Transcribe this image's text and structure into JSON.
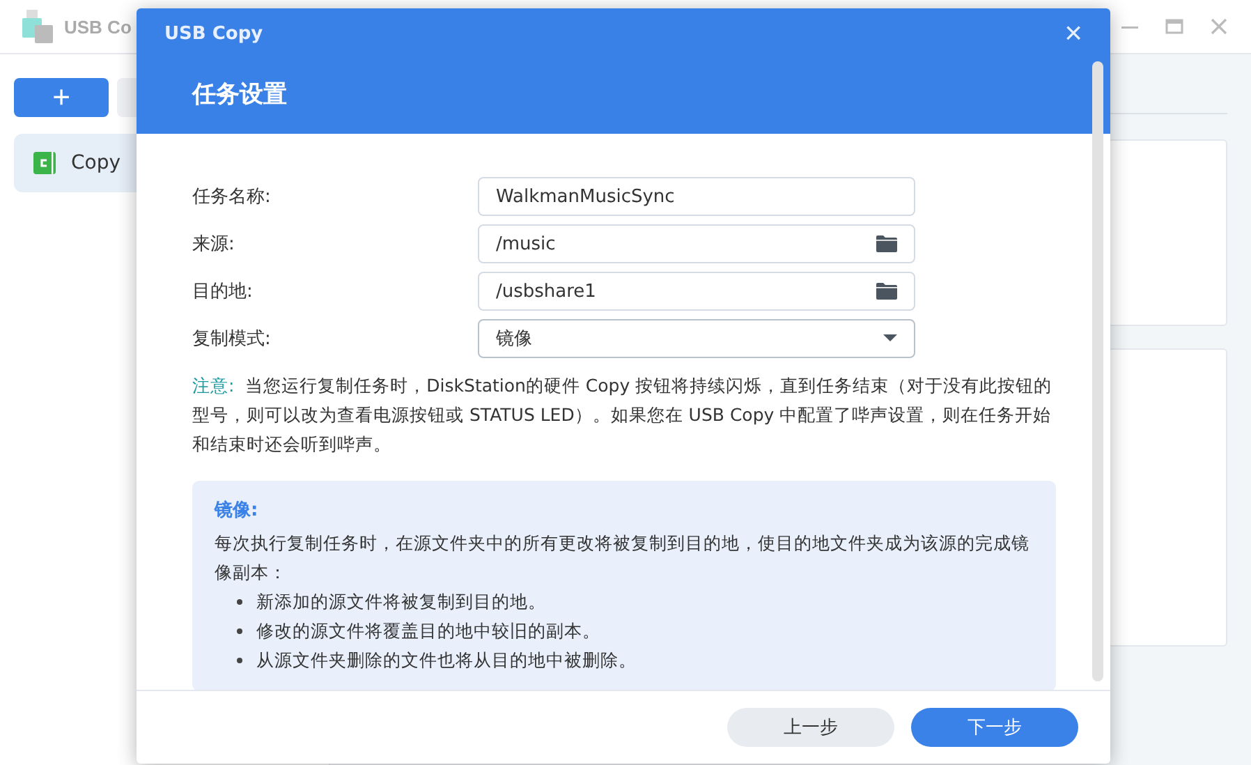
{
  "window": {
    "title": "USB Co"
  },
  "sidebar": {
    "add_button": "+",
    "items": [
      {
        "label": "Copy",
        "selected": true
      }
    ]
  },
  "dialog": {
    "title": "USB Copy",
    "close": "×",
    "heading": "任务设置",
    "fields": [
      {
        "label": "任务名称:",
        "kind": "text",
        "value": "WalkmanMusicSync"
      },
      {
        "label": "来源:",
        "kind": "folder",
        "value": "/music"
      },
      {
        "label": "目的地:",
        "kind": "folder",
        "value": "/usbshare1"
      },
      {
        "label": "复制模式:",
        "kind": "select",
        "value": "镜像"
      }
    ],
    "note_label": "注意:",
    "note": "当您运行复制任务时，DiskStation的硬件 Copy 按钮将持续闪烁，直到任务结束（对于没有此按钮的型号，则可以改为查看电源按钮或 STATUS LED）。如果您在 USB Copy 中配置了哔声设置，则在任务开始和结束时还会听到哔声。",
    "info": {
      "title": "镜像:",
      "text": "每次执行复制任务时，在源文件夹中的所有更改将被复制到目的地，使目的地文件夹成为该源的完成镜像副本：",
      "bullets": [
        "新添加的源文件将被复制到目的地。",
        "修改的源文件将覆盖目的地中较旧的副本。",
        "从源文件夹删除的文件也将从目的地中被删除。"
      ]
    },
    "buttons": [
      {
        "label": "上一步",
        "kind": "secondary"
      },
      {
        "label": "下一步",
        "kind": "primary"
      }
    ]
  }
}
